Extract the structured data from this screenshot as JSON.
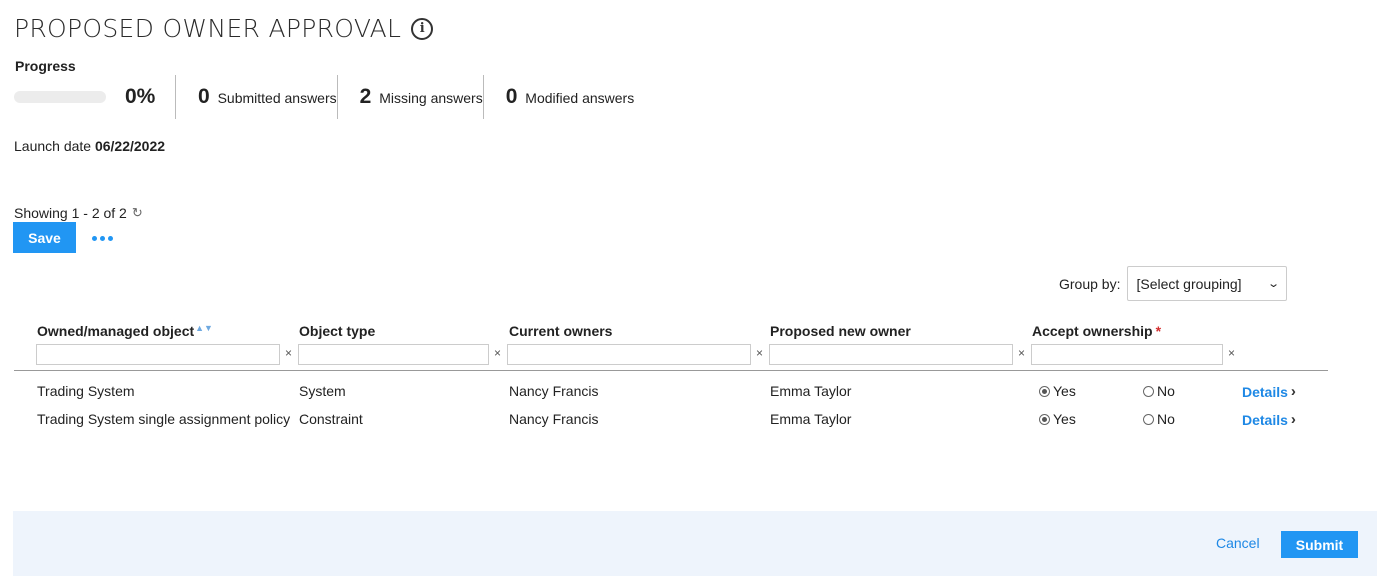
{
  "page": {
    "title": "PROPOSED OWNER APPROVAL",
    "info_icon": "info-icon"
  },
  "progress": {
    "label": "Progress",
    "percent_text": "0%",
    "fraction": 0,
    "submitted": {
      "count": "0",
      "label": "Submitted answers"
    },
    "missing": {
      "count": "2",
      "label": "Missing answers"
    },
    "modified": {
      "count": "0",
      "label": "Modified answers"
    }
  },
  "launch": {
    "label": "Launch date",
    "date": "06/22/2022"
  },
  "list": {
    "showing": "Showing 1 - 2 of 2",
    "refresh_icon": "refresh-icon"
  },
  "toolbar": {
    "save_label": "Save",
    "more_icon": "more-icon"
  },
  "groupby": {
    "label": "Group by:",
    "selected": "[Select grouping]"
  },
  "table": {
    "columns": [
      {
        "label": "Owned/managed object"
      },
      {
        "label": "Object type"
      },
      {
        "label": "Current owners"
      },
      {
        "label": "Proposed new owner"
      },
      {
        "label": "Accept ownership",
        "required": "*"
      }
    ],
    "clear_glyph": "×",
    "rows": [
      {
        "object": "Trading System",
        "type": "System",
        "current": "Nancy Francis",
        "proposed": "Emma Taylor",
        "yes": "Yes",
        "no": "No",
        "accept": "yes",
        "details": "Details"
      },
      {
        "object": "Trading System single assignment policy",
        "type": "Constraint",
        "current": "Nancy Francis",
        "proposed": "Emma Taylor",
        "yes": "Yes",
        "no": "No",
        "accept": "yes",
        "details": "Details"
      }
    ]
  },
  "footer": {
    "cancel_label": "Cancel",
    "submit_label": "Submit"
  },
  "colors": {
    "accent": "#2196f3",
    "link": "#1e88e5",
    "footer_bg": "#eef4fc",
    "required": "#d32f2f"
  }
}
